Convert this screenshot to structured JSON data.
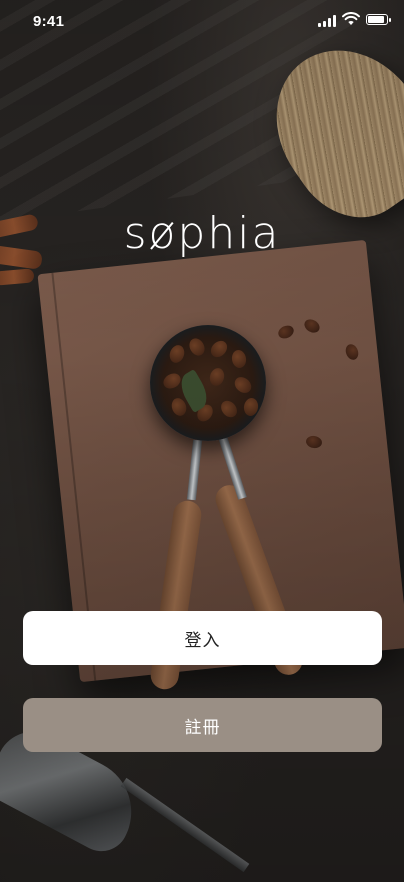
{
  "status_bar": {
    "time": "9:41"
  },
  "brand": {
    "logo_text": "søphia"
  },
  "actions": {
    "login_label": "登入",
    "register_label": "註冊"
  },
  "colors": {
    "login_bg": "#ffffff",
    "register_bg": "#9a8f85"
  }
}
